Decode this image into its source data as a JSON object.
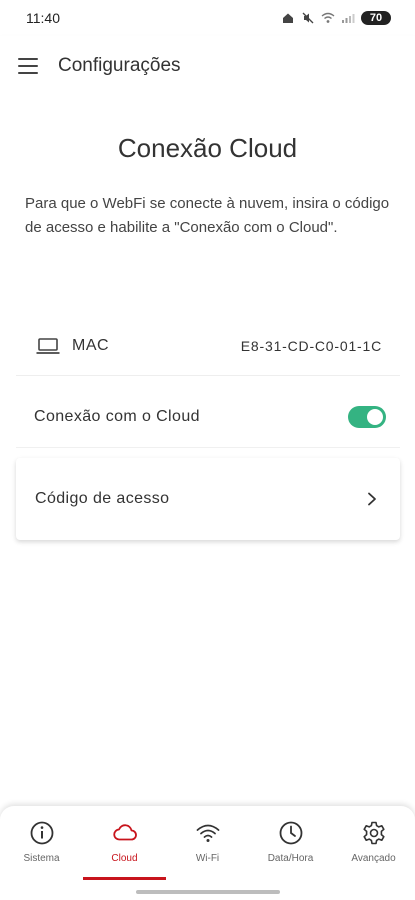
{
  "status_bar": {
    "time": "11:40",
    "battery": "70",
    "icons": [
      "home-icon",
      "mute-icon",
      "wifi-icon",
      "signal-icon"
    ]
  },
  "app_bar": {
    "title": "Configurações"
  },
  "page": {
    "heading": "Conexão Cloud",
    "description": "Para que o WebFi se conecte à nuvem, insira o código de acesso e habilite a \"Conexão com o Cloud\"."
  },
  "mac": {
    "label": "MAC",
    "value": "E8-31-CD-C0-01-1C"
  },
  "cloud_connection": {
    "label": "Conexão com o Cloud",
    "enabled": true
  },
  "access_code": {
    "label": "Código de acesso"
  },
  "bottom_nav": {
    "items": [
      {
        "label": "Sistema",
        "icon": "info-icon",
        "active": false
      },
      {
        "label": "Cloud",
        "icon": "cloud-icon",
        "active": true
      },
      {
        "label": "Wi-Fi",
        "icon": "wifi-icon",
        "active": false
      },
      {
        "label": "Data/Hora",
        "icon": "clock-icon",
        "active": false
      },
      {
        "label": "Avançado",
        "icon": "gear-icon",
        "active": false
      }
    ]
  },
  "colors": {
    "accent": "#c8141c",
    "toggle_on": "#34b382"
  }
}
